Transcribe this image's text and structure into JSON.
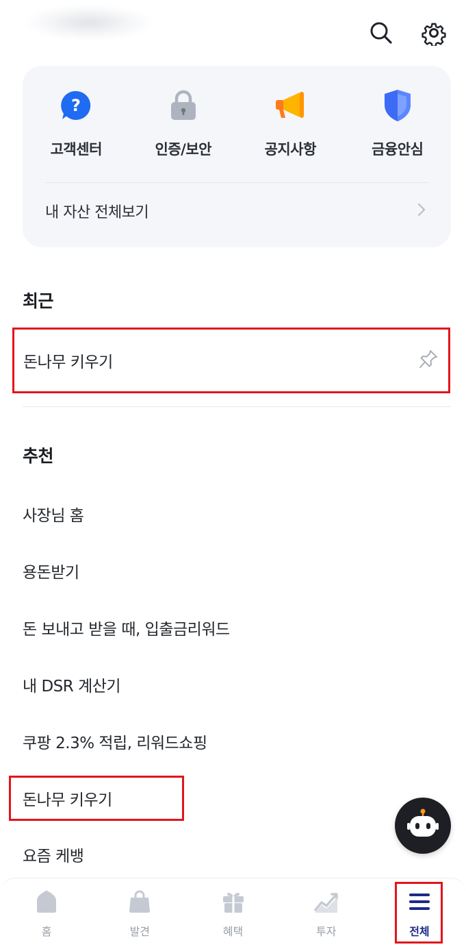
{
  "header": {
    "search_icon": "search-icon",
    "settings_icon": "gear-icon"
  },
  "quick_menu": {
    "items": [
      {
        "label": "고객센터",
        "icon": "help-icon",
        "color": "#1f6bf2"
      },
      {
        "label": "인증/보안",
        "icon": "lock-icon",
        "color": "#aeb4bf"
      },
      {
        "label": "공지사항",
        "icon": "megaphone-icon",
        "color": "#ffb400"
      },
      {
        "label": "금융안심",
        "icon": "shield-icon",
        "color": "#3d6bf5"
      }
    ],
    "asset_link": "내 자산 전체보기"
  },
  "recent": {
    "title": "최근",
    "items": [
      {
        "label": "돈나무 키우기",
        "icon": "pin-icon"
      }
    ]
  },
  "recommend": {
    "title": "추천",
    "items": [
      {
        "label": "사장님 홈"
      },
      {
        "label": "용돈받기"
      },
      {
        "label": "돈 보내고 받을 때, 입출금리워드"
      },
      {
        "label": "내 DSR 계산기"
      },
      {
        "label": "쿠팡 2.3% 적립, 리워드쇼핑"
      },
      {
        "label": "돈나무 키우기"
      },
      {
        "label": "요즘 케뱅"
      }
    ]
  },
  "chatbot": {
    "icon": "robot-icon"
  },
  "bottom_nav": {
    "items": [
      {
        "label": "홈",
        "icon": "home-icon",
        "active": false
      },
      {
        "label": "발견",
        "icon": "shopping-bag-icon",
        "active": false
      },
      {
        "label": "혜택",
        "icon": "gift-icon",
        "active": false
      },
      {
        "label": "투자",
        "icon": "chart-icon",
        "active": false
      },
      {
        "label": "전체",
        "icon": "menu-icon",
        "active": true
      }
    ]
  },
  "colors": {
    "highlight": "#e3141b",
    "active_nav": "#1c2a8a",
    "inactive_nav": "#c5cad2"
  }
}
